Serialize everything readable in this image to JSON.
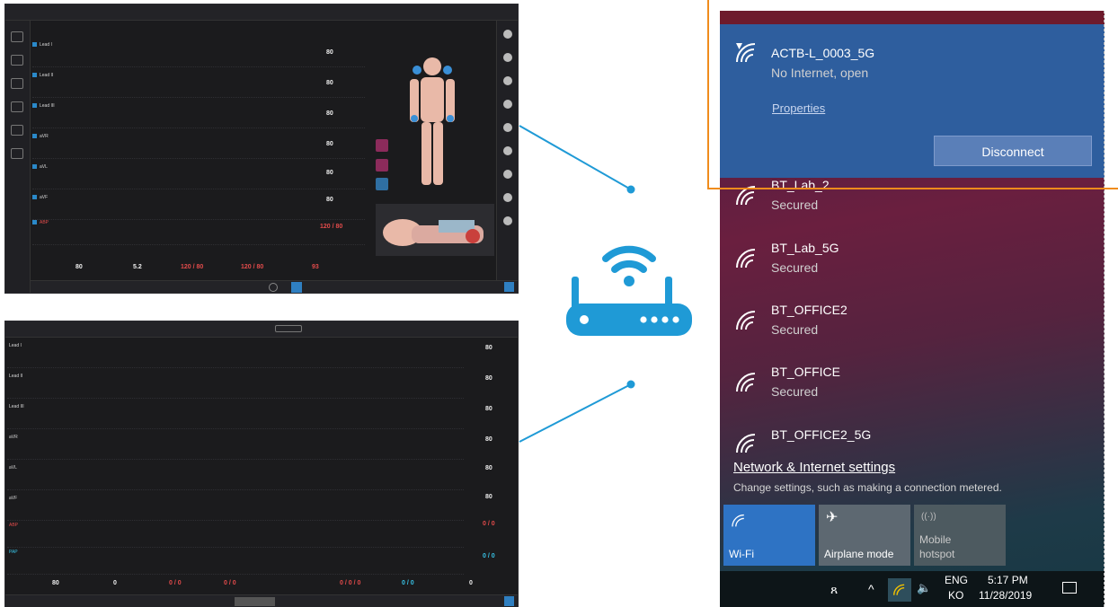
{
  "monitor_top": {
    "leads": [
      "Lead I",
      "Lead II",
      "Lead III",
      "aVR",
      "aVL",
      "aVF",
      "ABP"
    ],
    "hr_values": [
      "80",
      "80",
      "80",
      "80",
      "80",
      "80"
    ],
    "bp_display": "120 / 80",
    "bottom_values": [
      "80",
      "5.2",
      "120 / 80",
      "120 / 80",
      "93"
    ]
  },
  "monitor_bottom": {
    "leads": [
      "Lead I",
      "Lead II",
      "Lead III",
      "aVR",
      "aVL",
      "aVF",
      "ABP",
      "PAP"
    ],
    "hr_values": [
      "80",
      "80",
      "80",
      "80",
      "80",
      "80"
    ],
    "abp_display": "0 / 0",
    "pap_display": "0 / 0",
    "bottom_values": [
      "80",
      "0",
      "0 / 0",
      "0 / 0",
      "0 / 0 / 0",
      "0 / 0",
      "0"
    ]
  },
  "router": {
    "icon": "wifi-router-icon",
    "color": "#1f9ad6"
  },
  "flyout": {
    "connected": {
      "name": "ACTB-L_0003_5G",
      "status": "No Internet, open",
      "properties_label": "Properties",
      "disconnect_label": "Disconnect"
    },
    "networks": [
      {
        "name": "BT_Lab_2",
        "status": "Secured"
      },
      {
        "name": "BT_Lab_5G",
        "status": "Secured"
      },
      {
        "name": "BT_OFFICE2",
        "status": "Secured"
      },
      {
        "name": "BT_OFFICE",
        "status": "Secured"
      },
      {
        "name": "BT_OFFICE2_5G",
        "status": ""
      }
    ],
    "settings_link": "Network & Internet settings",
    "settings_sub": "Change settings, such as making a connection metered.",
    "tiles": {
      "wifi": "Wi-Fi",
      "airplane": "Airplane mode",
      "hotspot_line1": "Mobile",
      "hotspot_line2": "hotspot"
    },
    "taskbar": {
      "lang_top": "ENG",
      "lang_bottom": "KO",
      "time": "5:17 PM",
      "date": "11/28/2019"
    },
    "accent_color": "#2e5e9e",
    "highlight_color": "#f08c1c"
  }
}
